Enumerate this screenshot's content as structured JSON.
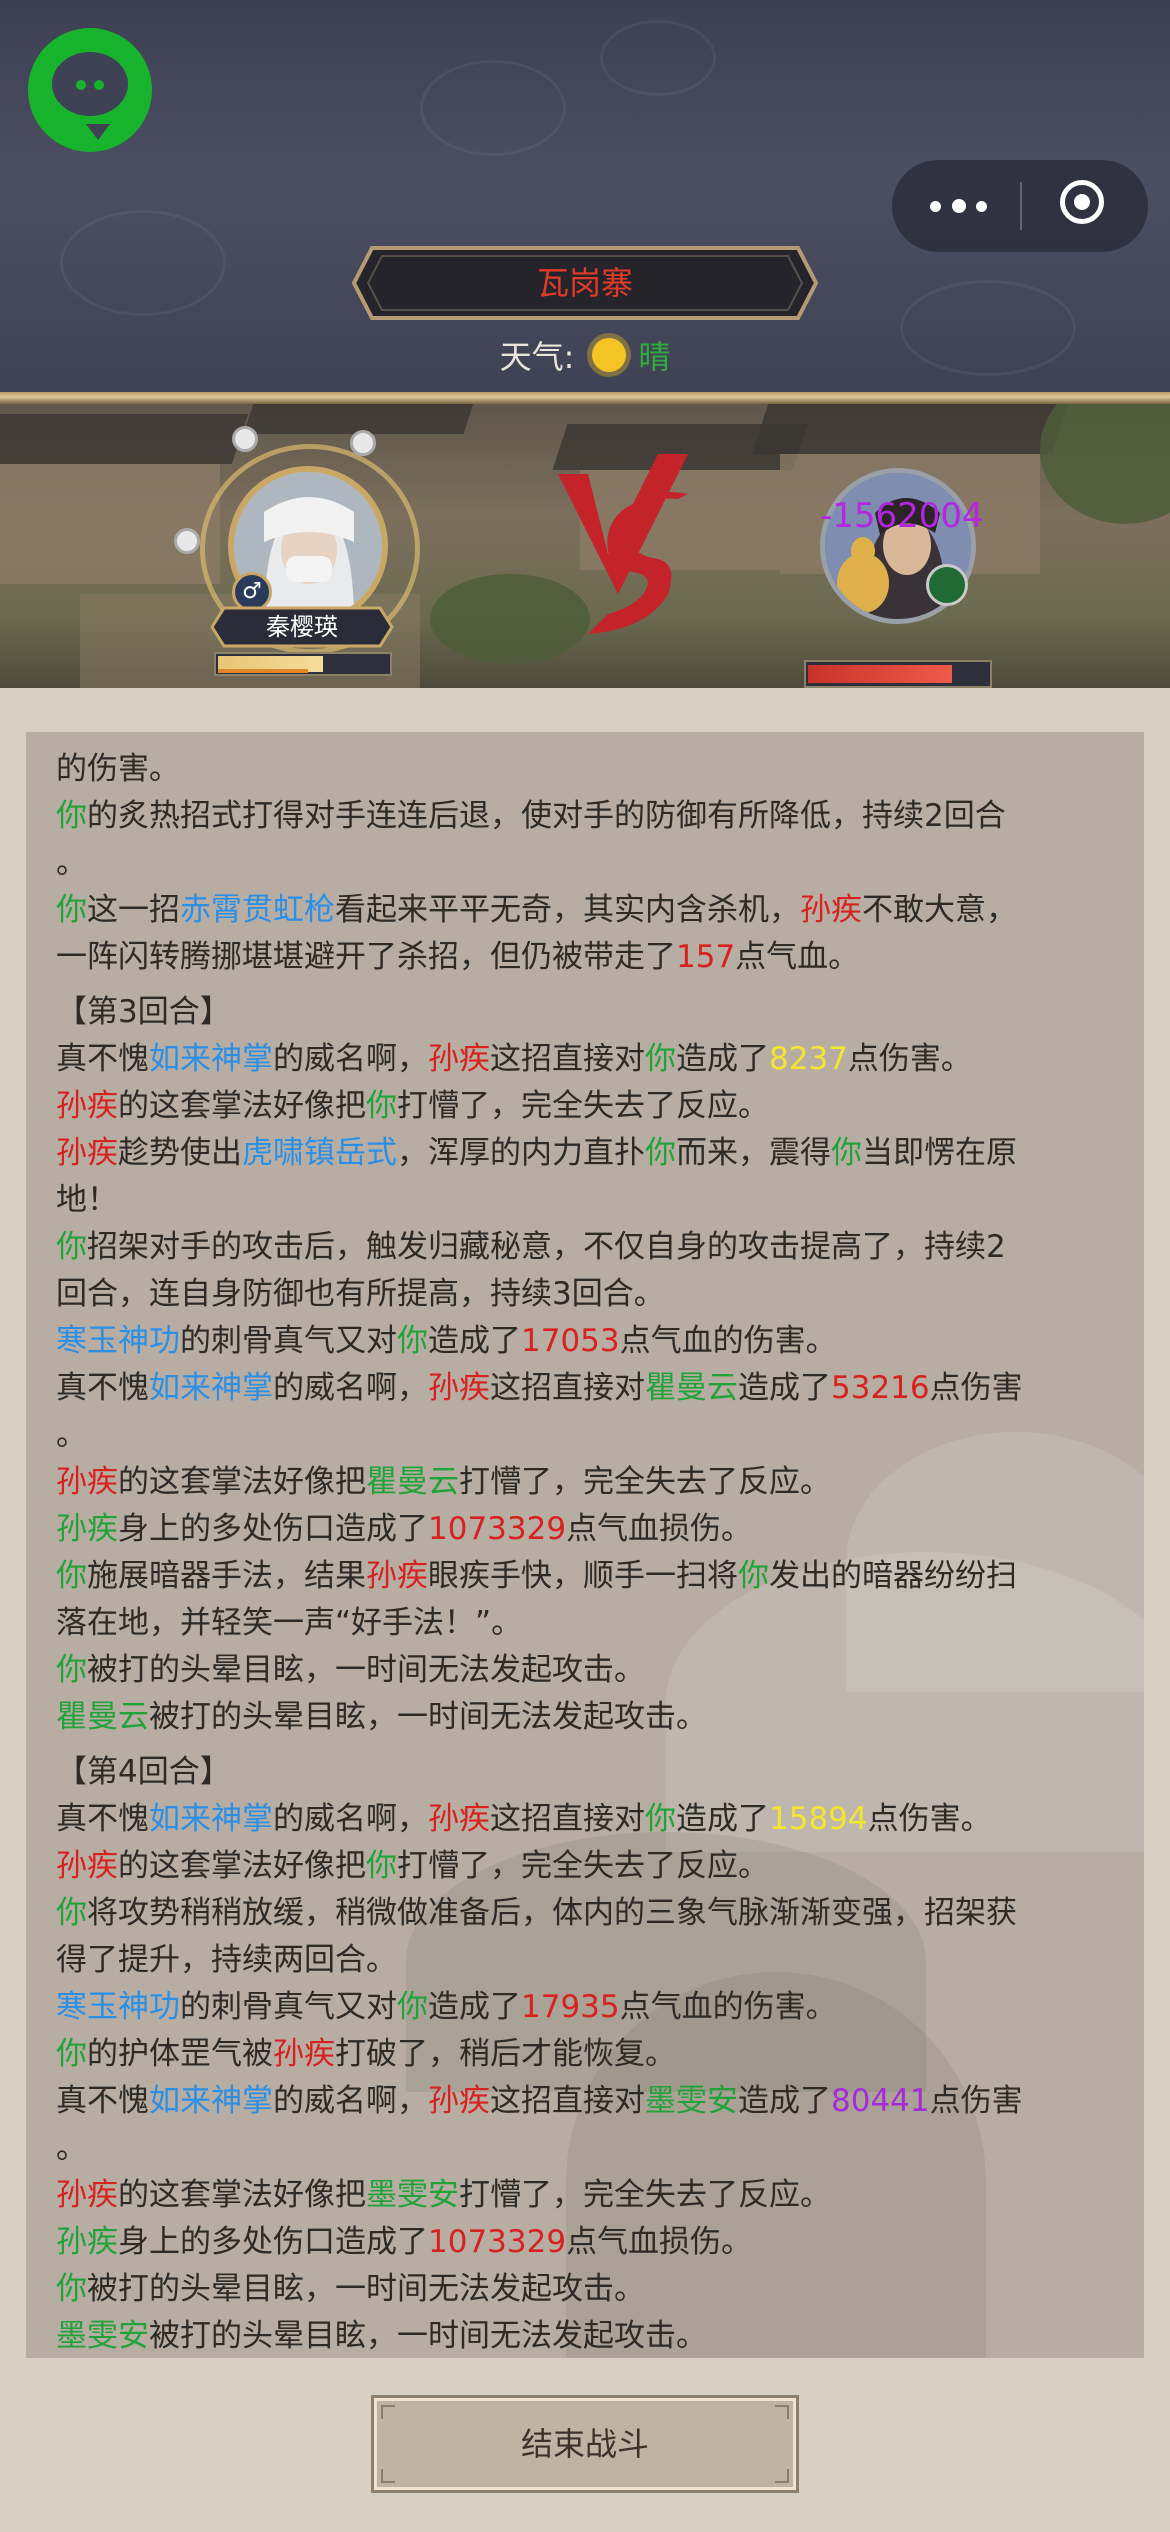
{
  "header": {
    "location": "瓦岗寨",
    "weather_label": "天气:",
    "weather_value": "晴"
  },
  "battle": {
    "player_name": "秦樱瑛",
    "player_hp_fraction": 0.62,
    "enemy_hp_fraction": 0.8,
    "enemy_damage_float": "-1562004",
    "vs_label": "VS"
  },
  "log": [
    [
      [
        "t",
        "的伤害。"
      ]
    ],
    [
      [
        "g",
        "你"
      ],
      [
        "t",
        "的炙热招式打得对手连连后退，使对手的防御有所降低，持续2回合"
      ]
    ],
    [
      [
        "t",
        "。"
      ]
    ],
    [
      [
        "g",
        "你"
      ],
      [
        "t",
        "这一招"
      ],
      [
        "b",
        "赤霄贯虹枪"
      ],
      [
        "t",
        "看起来平平无奇，其实内含杀机，"
      ],
      [
        "r",
        "孙疾"
      ],
      [
        "t",
        "不敢大意，"
      ]
    ],
    [
      [
        "t",
        "一阵闪转腾挪堪堪避开了杀招，但仍被带走了"
      ],
      [
        "r",
        "157"
      ],
      [
        "t",
        "点气血。"
      ]
    ],
    [
      [
        "round",
        "【第3回合】"
      ]
    ],
    [
      [
        "t",
        "真不愧"
      ],
      [
        "b",
        "如来神掌"
      ],
      [
        "t",
        "的威名啊，"
      ],
      [
        "r",
        "孙疾"
      ],
      [
        "t",
        "这招直接对"
      ],
      [
        "g",
        "你"
      ],
      [
        "t",
        "造成了"
      ],
      [
        "y",
        "8237"
      ],
      [
        "t",
        "点伤害。"
      ]
    ],
    [
      [
        "r",
        "孙疾"
      ],
      [
        "t",
        "的这套掌法好像把"
      ],
      [
        "g",
        "你"
      ],
      [
        "t",
        "打懵了，完全失去了反应。"
      ]
    ],
    [
      [
        "r",
        "孙疾"
      ],
      [
        "t",
        "趁势使出"
      ],
      [
        "b",
        "虎啸镇岳式"
      ],
      [
        "t",
        "，浑厚的内力直扑"
      ],
      [
        "g",
        "你"
      ],
      [
        "t",
        "而来，震得"
      ],
      [
        "g",
        "你"
      ],
      [
        "t",
        "当即愣在原"
      ]
    ],
    [
      [
        "t",
        "地！"
      ]
    ],
    [
      [
        "g",
        "你"
      ],
      [
        "t",
        "招架对手的攻击后，触发归藏秘意，不仅自身的攻击提高了，持续2"
      ]
    ],
    [
      [
        "t",
        "回合，连自身防御也有所提高，持续3回合。"
      ]
    ],
    [
      [
        "b",
        "寒玉神功"
      ],
      [
        "t",
        "的刺骨真气又对"
      ],
      [
        "g",
        "你"
      ],
      [
        "t",
        "造成了"
      ],
      [
        "r",
        "17053"
      ],
      [
        "t",
        "点气血的伤害。"
      ]
    ],
    [
      [
        "t",
        "真不愧"
      ],
      [
        "b",
        "如来神掌"
      ],
      [
        "t",
        "的威名啊，"
      ],
      [
        "r",
        "孙疾"
      ],
      [
        "t",
        "这招直接对"
      ],
      [
        "g",
        "瞿曼云"
      ],
      [
        "t",
        "造成了"
      ],
      [
        "r",
        "53216"
      ],
      [
        "t",
        "点伤害"
      ]
    ],
    [
      [
        "t",
        "。"
      ]
    ],
    [
      [
        "r",
        "孙疾"
      ],
      [
        "t",
        "的这套掌法好像把"
      ],
      [
        "g",
        "瞿曼云"
      ],
      [
        "t",
        "打懵了，完全失去了反应。"
      ]
    ],
    [
      [
        "g",
        "孙疾"
      ],
      [
        "t",
        "身上的多处伤口造成了"
      ],
      [
        "r",
        "1073329"
      ],
      [
        "t",
        "点气血损伤。"
      ]
    ],
    [
      [
        "g",
        "你"
      ],
      [
        "t",
        "施展暗器手法，结果"
      ],
      [
        "r",
        "孙疾"
      ],
      [
        "t",
        "眼疾手快，顺手一扫将"
      ],
      [
        "g",
        "你"
      ],
      [
        "t",
        "发出的暗器纷纷扫"
      ]
    ],
    [
      [
        "t",
        "落在地，并轻笑一声“好手法！”。"
      ]
    ],
    [
      [
        "g",
        "你"
      ],
      [
        "t",
        "被打的头晕目眩，一时间无法发起攻击。"
      ]
    ],
    [
      [
        "g",
        "瞿曼云"
      ],
      [
        "t",
        "被打的头晕目眩，一时间无法发起攻击。"
      ]
    ],
    [
      [
        "round",
        "【第4回合】"
      ]
    ],
    [
      [
        "t",
        "真不愧"
      ],
      [
        "b",
        "如来神掌"
      ],
      [
        "t",
        "的威名啊，"
      ],
      [
        "r",
        "孙疾"
      ],
      [
        "t",
        "这招直接对"
      ],
      [
        "g",
        "你"
      ],
      [
        "t",
        "造成了"
      ],
      [
        "y",
        "15894"
      ],
      [
        "t",
        "点伤害。"
      ]
    ],
    [
      [
        "r",
        "孙疾"
      ],
      [
        "t",
        "的这套掌法好像把"
      ],
      [
        "g",
        "你"
      ],
      [
        "t",
        "打懵了，完全失去了反应。"
      ]
    ],
    [
      [
        "g",
        "你"
      ],
      [
        "t",
        "将攻势稍稍放缓，稍微做准备后，体内的三象气脉渐渐变强，招架获"
      ]
    ],
    [
      [
        "t",
        "得了提升，持续两回合。"
      ]
    ],
    [
      [
        "b",
        "寒玉神功"
      ],
      [
        "t",
        "的刺骨真气又对"
      ],
      [
        "g",
        "你"
      ],
      [
        "t",
        "造成了"
      ],
      [
        "r",
        "17935"
      ],
      [
        "t",
        "点气血的伤害。"
      ]
    ],
    [
      [
        "g",
        "你"
      ],
      [
        "t",
        "的护体罡气被"
      ],
      [
        "r",
        "孙疾"
      ],
      [
        "t",
        "打破了，稍后才能恢复。"
      ]
    ],
    [
      [
        "t",
        "真不愧"
      ],
      [
        "b",
        "如来神掌"
      ],
      [
        "t",
        "的威名啊，"
      ],
      [
        "r",
        "孙疾"
      ],
      [
        "t",
        "这招直接对"
      ],
      [
        "g",
        "墨雯安"
      ],
      [
        "t",
        "造成了"
      ],
      [
        "p",
        "80441"
      ],
      [
        "t",
        "点伤害"
      ]
    ],
    [
      [
        "t",
        "。"
      ]
    ],
    [
      [
        "r",
        "孙疾"
      ],
      [
        "t",
        "的这套掌法好像把"
      ],
      [
        "g",
        "墨雯安"
      ],
      [
        "t",
        "打懵了，完全失去了反应。"
      ]
    ],
    [
      [
        "g",
        "孙疾"
      ],
      [
        "t",
        "身上的多处伤口造成了"
      ],
      [
        "r",
        "1073329"
      ],
      [
        "t",
        "点气血损伤。"
      ]
    ],
    [
      [
        "g",
        "你"
      ],
      [
        "t",
        "被打的头晕目眩，一时间无法发起攻击。"
      ]
    ],
    [
      [
        "g",
        "墨雯安"
      ],
      [
        "t",
        "被打的头晕目眩，一时间无法发起攻击。"
      ]
    ]
  ],
  "footer": {
    "end_battle_label": "结束战斗"
  }
}
